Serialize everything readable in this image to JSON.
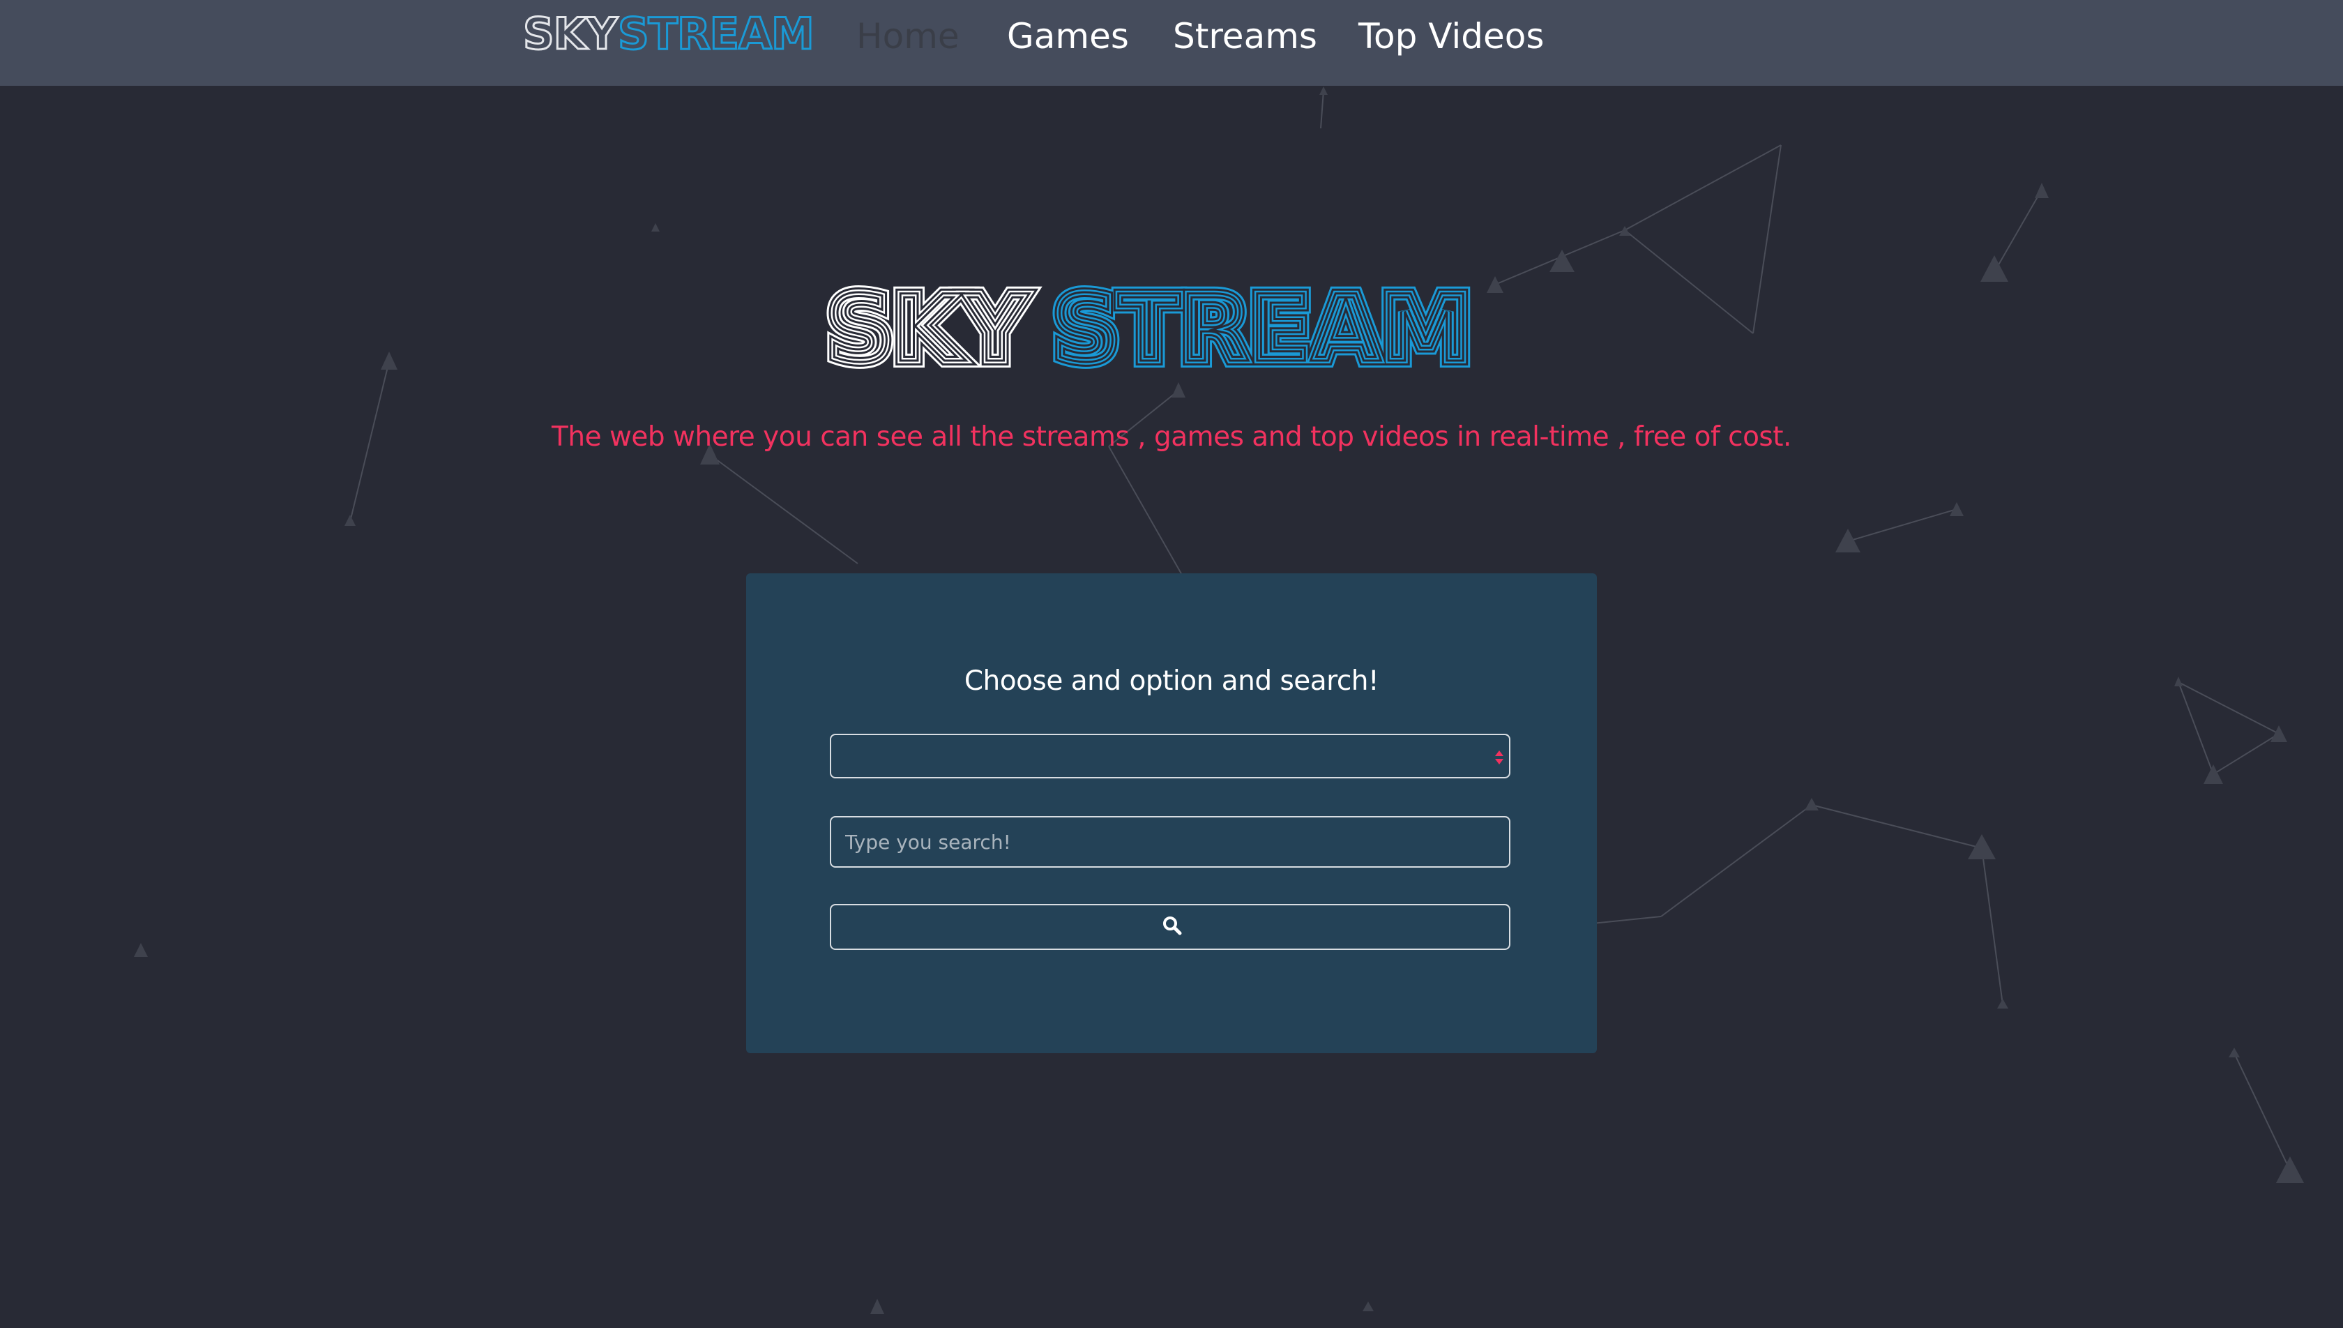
{
  "navbar": {
    "logo": {
      "sky": "SKY",
      "stream": "STREAM"
    },
    "links": [
      {
        "label": "Home",
        "active": true
      },
      {
        "label": "Games",
        "active": false
      },
      {
        "label": "Streams",
        "active": false
      },
      {
        "label": "Top Videos",
        "active": false
      }
    ]
  },
  "hero": {
    "logo": {
      "sky": "SKY",
      "stream": "STREAM"
    },
    "tagline": "The web where you can see all the streams , games and top videos in real-time , free of cost."
  },
  "search_card": {
    "title": "Choose and option and search!",
    "select": {
      "selected_value": ""
    },
    "input": {
      "value": "",
      "placeholder": "Type you search!"
    },
    "button": {
      "icon": "search-icon"
    }
  },
  "colors": {
    "background": "#282a35",
    "navbar": "#454c5c",
    "brand_blue": "#1a9ad6",
    "tagline_pink": "#f2325f",
    "card": "#244257"
  }
}
